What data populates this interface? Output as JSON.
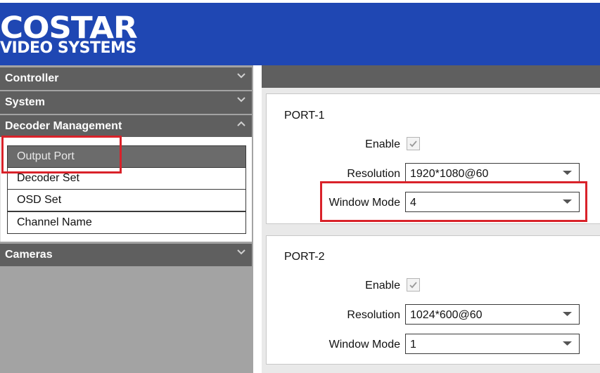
{
  "header": {
    "logo_top": "COSTAR",
    "logo_bottom": "VIDEO SYSTEMS",
    "logo_icon": "costar-logo",
    "brand_color": "#1f47b3"
  },
  "sidebar": {
    "menus": [
      {
        "label": "Controller",
        "state": "collapsed"
      },
      {
        "label": "System",
        "state": "collapsed"
      },
      {
        "label": "Decoder Management",
        "state": "expanded"
      },
      {
        "label": "Cameras",
        "state": "collapsed"
      }
    ],
    "decoder_items": [
      {
        "label": "Output Port",
        "active": true
      },
      {
        "label": "Decoder Set",
        "active": false
      },
      {
        "label": "OSD Set",
        "active": false
      },
      {
        "label": "Channel Name",
        "active": false
      }
    ]
  },
  "ports": [
    {
      "title": "PORT-1",
      "enable_label": "Enable",
      "enabled": true,
      "resolution_label": "Resolution",
      "resolution_value": "1920*1080@60",
      "window_mode_label": "Window Mode",
      "window_mode_value": "4"
    },
    {
      "title": "PORT-2",
      "enable_label": "Enable",
      "enabled": true,
      "resolution_label": "Resolution",
      "resolution_value": "1024*600@60",
      "window_mode_label": "Window Mode",
      "window_mode_value": "1"
    }
  ],
  "colors": {
    "highlight": "#d9222a",
    "menu_bg": "#5f5f5f",
    "active_item_bg": "#6b6b6b"
  }
}
